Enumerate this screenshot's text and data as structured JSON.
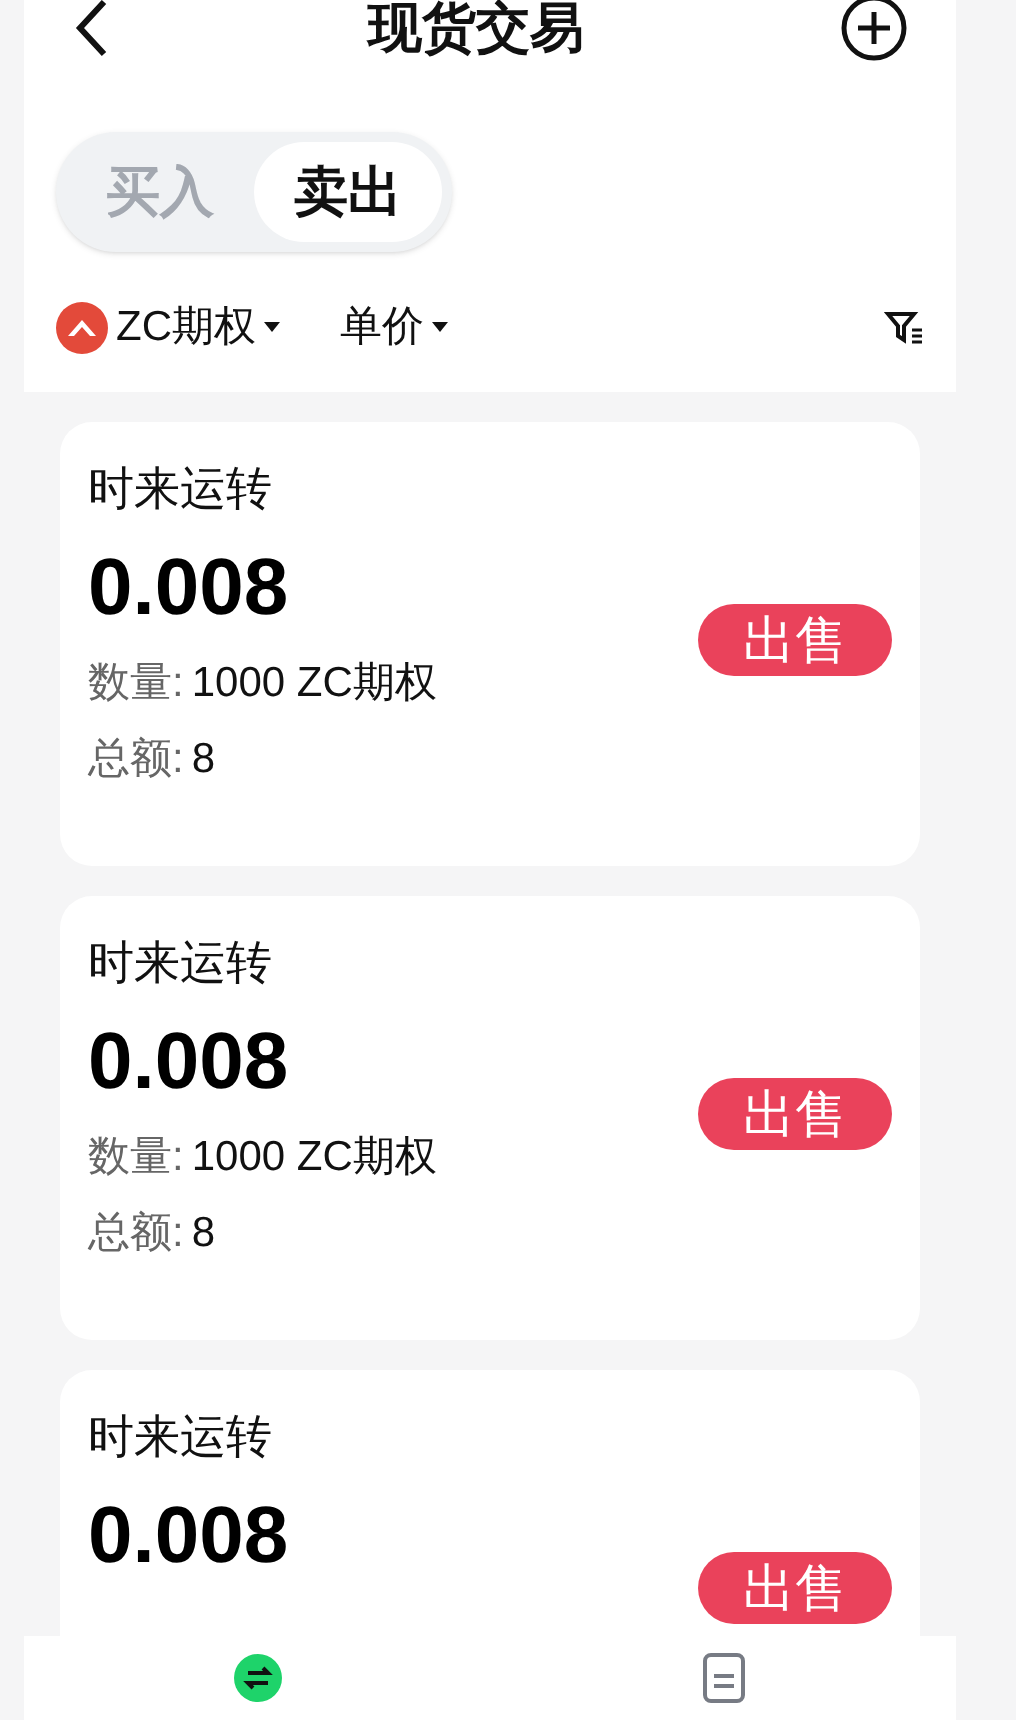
{
  "header": {
    "title": "现货交易"
  },
  "tabs": [
    {
      "label": "买入",
      "selected": false
    },
    {
      "label": "卖出",
      "selected": true
    }
  ],
  "filters": [
    {
      "label": "ZC期权",
      "kind": "token"
    },
    {
      "label": "单价",
      "kind": "plain"
    }
  ],
  "orders": [
    {
      "name": "时来运转",
      "price": "0.008",
      "quantity_label": "数量:",
      "quantity_value": "1000 ZC期权",
      "total_label": "总额:",
      "total_value": "8",
      "action": "出售"
    },
    {
      "name": "时来运转",
      "price": "0.008",
      "quantity_label": "数量:",
      "quantity_value": "1000 ZC期权",
      "total_label": "总额:",
      "total_value": "8",
      "action": "出售"
    },
    {
      "name": "时来运转",
      "price": "0.008",
      "action": "出售"
    }
  ],
  "bottom_nav": [
    {
      "kind": "trade",
      "selected": true
    },
    {
      "kind": "orders",
      "selected": false
    }
  ]
}
